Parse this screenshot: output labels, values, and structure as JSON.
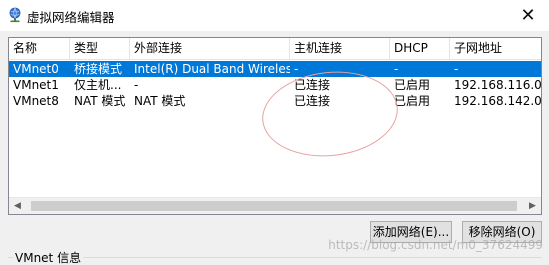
{
  "window": {
    "title": "虚拟网络编辑器",
    "close_glyph": "✕"
  },
  "table": {
    "columns": [
      "名称",
      "类型",
      "外部连接",
      "主机连接",
      "DHCP",
      "子网地址"
    ],
    "rows": [
      [
        "VMnet0",
        "桥接模式",
        "Intel(R) Dual Band Wireless-A...",
        "-",
        "-",
        "-"
      ],
      [
        "VMnet1",
        "仅主机...",
        "-",
        "已连接",
        "已启用",
        "192.168.116.0"
      ],
      [
        "VMnet8",
        "NAT 模式",
        "NAT 模式",
        "已连接",
        "已启用",
        "192.168.142.0"
      ]
    ],
    "selected_row": 0
  },
  "scrollbar": {
    "left_arrow": "◀",
    "right_arrow": "▶"
  },
  "buttons": {
    "add_network": "添加网络(E)...",
    "remove_network": "移除网络(O)"
  },
  "info_group": {
    "label": "VMnet 信息"
  },
  "watermark": "https://blog.csdn.net/m0_37624499",
  "colors": {
    "selection": "#0078d7",
    "annotation": "#e8a0a0"
  }
}
